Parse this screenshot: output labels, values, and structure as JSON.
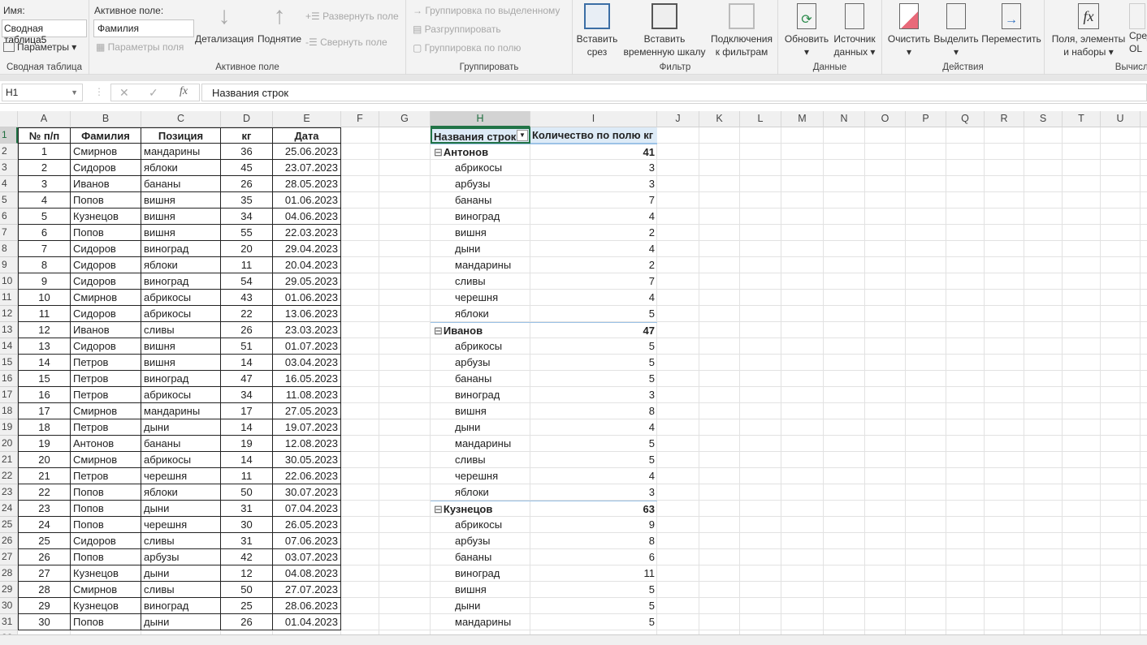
{
  "ribbon": {
    "pivot": {
      "name_label": "Имя:",
      "name_value": "Сводная таблица5",
      "params": "Параметры",
      "group": "Сводная таблица"
    },
    "active": {
      "label": "Активное поле:",
      "value": "Фамилия",
      "field_params": "Параметры поля",
      "drill_down": "Детализация",
      "drill_up": "Поднятие",
      "expand": "Развернуть поле",
      "collapse": "Свернуть поле",
      "group": "Активное поле"
    },
    "grouping": {
      "by_selection": "Группировка по выделенному",
      "ungroup": "Разгруппировать",
      "by_field": "Группировка по полю",
      "group": "Группировать"
    },
    "filter": {
      "slicer1": "Вставить",
      "slicer2": "срез",
      "timeline1": "Вставить",
      "timeline2": "временную шкалу",
      "conn1": "Подключения",
      "conn2": "к фильтрам",
      "group": "Фильтр"
    },
    "data": {
      "refresh": "Обновить",
      "source1": "Источник",
      "source2": "данных",
      "group": "Данные"
    },
    "actions": {
      "clear": "Очистить",
      "select": "Выделить",
      "move": "Переместить",
      "group": "Действия"
    },
    "calc": {
      "fields1": "Поля, элементы",
      "fields2": "и наборы",
      "olap1": "Сред",
      "olap2": "OL",
      "group": "Вычисле"
    }
  },
  "formula": {
    "namebox": "H1",
    "content": "Названия строк"
  },
  "columns": [
    "A",
    "B",
    "C",
    "D",
    "E",
    "F",
    "G",
    "H",
    "I",
    "J",
    "K",
    "L",
    "M",
    "N",
    "O",
    "P",
    "Q",
    "R",
    "S",
    "T",
    "U"
  ],
  "table": {
    "headers": [
      "№ п/п",
      "Фамилия",
      "Позиция",
      "кг",
      "Дата"
    ],
    "rows": [
      [
        1,
        "Смирнов",
        "мандарины",
        36,
        "25.06.2023"
      ],
      [
        2,
        "Сидоров",
        "яблоки",
        45,
        "23.07.2023"
      ],
      [
        3,
        "Иванов",
        "бананы",
        26,
        "28.05.2023"
      ],
      [
        4,
        "Попов",
        "вишня",
        35,
        "01.06.2023"
      ],
      [
        5,
        "Кузнецов",
        "вишня",
        34,
        "04.06.2023"
      ],
      [
        6,
        "Попов",
        "вишня",
        55,
        "22.03.2023"
      ],
      [
        7,
        "Сидоров",
        "виноград",
        20,
        "29.04.2023"
      ],
      [
        8,
        "Сидоров",
        "яблоки",
        11,
        "20.04.2023"
      ],
      [
        9,
        "Сидоров",
        "виноград",
        54,
        "29.05.2023"
      ],
      [
        10,
        "Смирнов",
        "абрикосы",
        43,
        "01.06.2023"
      ],
      [
        11,
        "Сидоров",
        "абрикосы",
        22,
        "13.06.2023"
      ],
      [
        12,
        "Иванов",
        "сливы",
        26,
        "23.03.2023"
      ],
      [
        13,
        "Сидоров",
        "вишня",
        51,
        "01.07.2023"
      ],
      [
        14,
        "Петров",
        "вишня",
        14,
        "03.04.2023"
      ],
      [
        15,
        "Петров",
        "виноград",
        47,
        "16.05.2023"
      ],
      [
        16,
        "Петров",
        "абрикосы",
        34,
        "11.08.2023"
      ],
      [
        17,
        "Смирнов",
        "мандарины",
        17,
        "27.05.2023"
      ],
      [
        18,
        "Петров",
        "дыни",
        14,
        "19.07.2023"
      ],
      [
        19,
        "Антонов",
        "бананы",
        19,
        "12.08.2023"
      ],
      [
        20,
        "Смирнов",
        "абрикосы",
        14,
        "30.05.2023"
      ],
      [
        21,
        "Петров",
        "черешня",
        11,
        "22.06.2023"
      ],
      [
        22,
        "Попов",
        "яблоки",
        50,
        "30.07.2023"
      ],
      [
        23,
        "Попов",
        "дыни",
        31,
        "07.04.2023"
      ],
      [
        24,
        "Попов",
        "черешня",
        30,
        "26.05.2023"
      ],
      [
        25,
        "Сидоров",
        "сливы",
        31,
        "07.06.2023"
      ],
      [
        26,
        "Попов",
        "арбузы",
        42,
        "03.07.2023"
      ],
      [
        27,
        "Кузнецов",
        "дыни",
        12,
        "04.08.2023"
      ],
      [
        28,
        "Смирнов",
        "сливы",
        50,
        "27.07.2023"
      ],
      [
        29,
        "Кузнецов",
        "виноград",
        25,
        "28.06.2023"
      ],
      [
        30,
        "Попов",
        "дыни",
        26,
        "01.04.2023"
      ]
    ]
  },
  "pivot": {
    "row_header": "Названия строк",
    "value_header": "Количество по полю кг",
    "groups": [
      {
        "name": "Антонов",
        "total": 41,
        "items": [
          [
            "абрикосы",
            3
          ],
          [
            "арбузы",
            3
          ],
          [
            "бананы",
            7
          ],
          [
            "виноград",
            4
          ],
          [
            "вишня",
            2
          ],
          [
            "дыни",
            4
          ],
          [
            "мандарины",
            2
          ],
          [
            "сливы",
            7
          ],
          [
            "черешня",
            4
          ],
          [
            "яблоки",
            5
          ]
        ]
      },
      {
        "name": "Иванов",
        "total": 47,
        "items": [
          [
            "абрикосы",
            5
          ],
          [
            "арбузы",
            5
          ],
          [
            "бананы",
            5
          ],
          [
            "виноград",
            3
          ],
          [
            "вишня",
            8
          ],
          [
            "дыни",
            4
          ],
          [
            "мандарины",
            5
          ],
          [
            "сливы",
            5
          ],
          [
            "черешня",
            4
          ],
          [
            "яблоки",
            3
          ]
        ]
      },
      {
        "name": "Кузнецов",
        "total": 63,
        "items": [
          [
            "абрикосы",
            9
          ],
          [
            "арбузы",
            8
          ],
          [
            "бананы",
            6
          ],
          [
            "виноград",
            11
          ],
          [
            "вишня",
            5
          ],
          [
            "дыни",
            5
          ],
          [
            "мандарины",
            5
          ]
        ]
      }
    ]
  },
  "colors": {
    "accent": "#217346",
    "pivot_header": "#ddebf7"
  }
}
